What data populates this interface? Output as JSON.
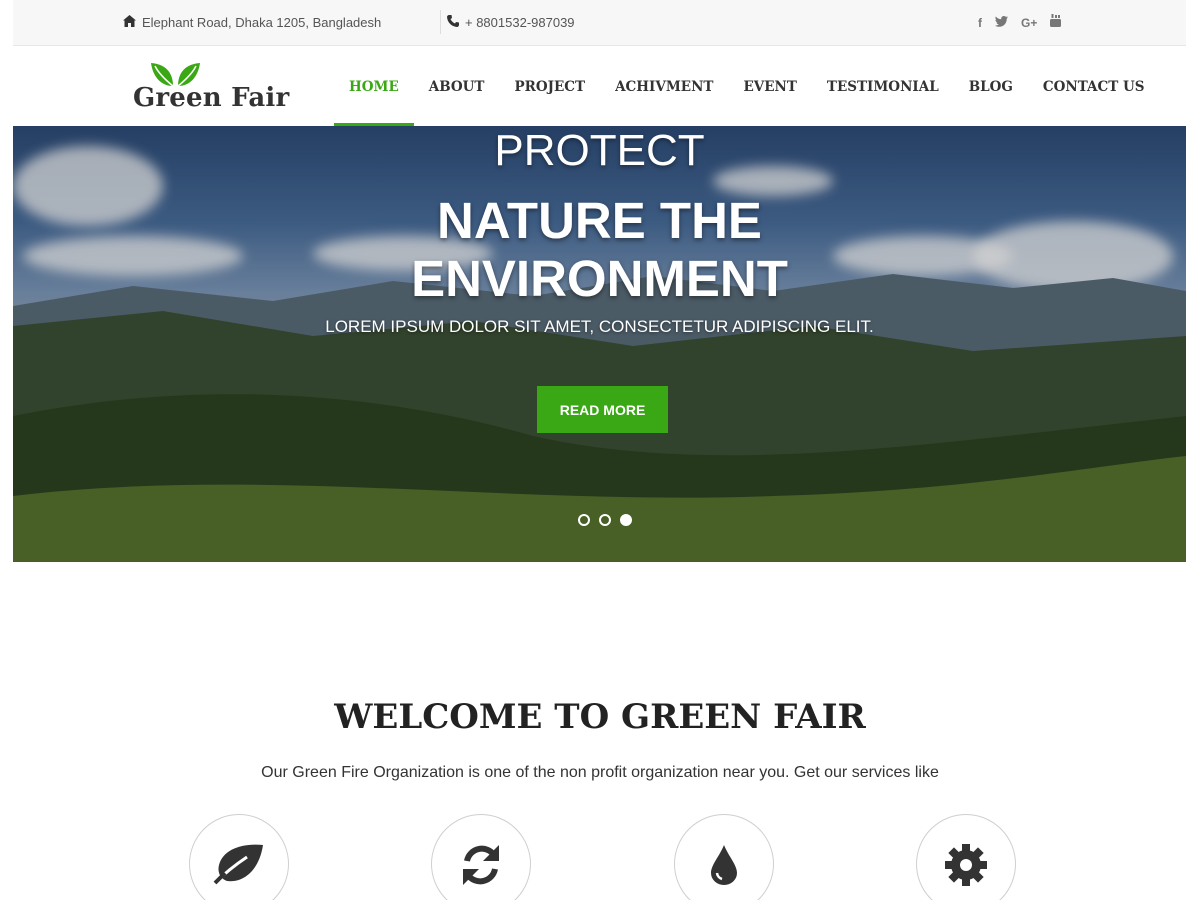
{
  "topbar": {
    "address": "Elephant Road, Dhaka 1205, Bangladesh",
    "phone": "+ 8801532-987039",
    "social": [
      {
        "icon": "facebook-icon",
        "glyph": "f"
      },
      {
        "icon": "twitter-icon",
        "glyph": "t"
      },
      {
        "icon": "google-plus-icon",
        "glyph": "G+"
      },
      {
        "icon": "youtube-icon",
        "glyph": "yt"
      }
    ]
  },
  "logo": {
    "brand": "Green Fair",
    "color": "#3aa815"
  },
  "nav": [
    {
      "label": "HOME",
      "active": true
    },
    {
      "label": "ABOUT"
    },
    {
      "label": "PROJECT"
    },
    {
      "label": "ACHIVMENT"
    },
    {
      "label": "EVENT"
    },
    {
      "label": "TESTIMONIAL"
    },
    {
      "label": "BLOG"
    },
    {
      "label": "CONTACT US"
    }
  ],
  "hero": {
    "line1": "PROTECT",
    "line2": "NATURE THE",
    "line3": "ENVIRONMENT",
    "subtitle": "LOREM IPSUM DOLOR SIT AMET, CONSECTETUR ADIPISCING ELIT.",
    "button": "READ MORE",
    "slides": 3,
    "active_slide": 3
  },
  "welcome": {
    "title": "WELCOME TO GREEN FAIR",
    "text": "Our Green Fire Organization is one of the non profit organization near you. Get our services like"
  },
  "services": [
    {
      "icon": "leaf-icon"
    },
    {
      "icon": "refresh-icon"
    },
    {
      "icon": "drop-icon"
    },
    {
      "icon": "gear-icon"
    }
  ],
  "colors": {
    "accent": "#3aa815",
    "topbar_bg": "#f7f7f7",
    "text": "#333333"
  }
}
